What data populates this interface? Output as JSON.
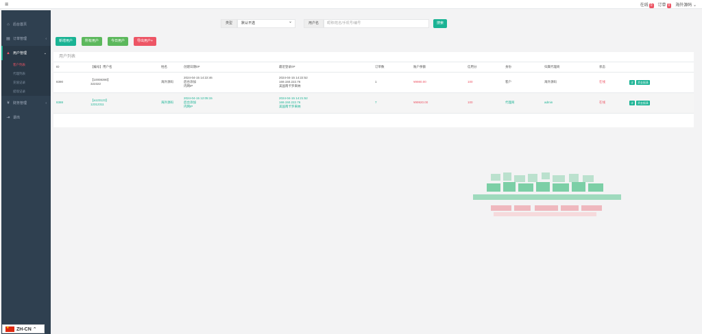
{
  "top": {
    "menu_icon": "hamburger-icon",
    "online_label": "在线",
    "online_count": "0",
    "orders_label": "订单",
    "orders_count": "0",
    "user": "海外源码 ⌄"
  },
  "sidebar": {
    "items": [
      {
        "label": "后台首页",
        "icon": "home-icon"
      },
      {
        "label": "订单管理",
        "icon": "order-icon"
      },
      {
        "label": "用户管理",
        "icon": "user-icon"
      },
      {
        "label": "财务管理",
        "icon": "money-icon"
      },
      {
        "label": "退出",
        "icon": "exit-icon"
      }
    ],
    "sub_items": [
      "客户列表",
      "代理列表",
      "充值记录",
      "提现记录"
    ]
  },
  "language": "ZH-CN ⌃",
  "search": {
    "type_label": "类型",
    "type_value": "默认不选",
    "user_label": "用户名",
    "user_placeholder": "昵称/姓名/手机号/编号",
    "button": "搜索"
  },
  "actions": [
    "新增用户",
    "所有用户",
    "今日用户",
    "导出用户+"
  ],
  "panel_title": "用户列表",
  "table": {
    "headers": [
      "ID",
      "【编号】用户名",
      "姓名",
      "创建日期/IP",
      "最近登录/IP",
      "订单数",
      "账户余额",
      "信用分",
      "身份",
      "归属代理商",
      "状态",
      ""
    ],
    "rows": [
      {
        "id": "8390",
        "user_line1": "【10008390】",
        "user_line2": "322322",
        "name": "海外源码",
        "created_line1": "2024-04-15 14:22:46",
        "created_line2": "后台添加",
        "created_line3": "内网IP",
        "login_line1": "2024-04-15 14:22:52",
        "login_line2": "169.150.222.76",
        "login_line3": "美国南卡罗来纳",
        "orders": "1",
        "balance": "¥9980.00",
        "credit": "100",
        "role": "客户",
        "agent": "海外源码",
        "status": "在线",
        "btn1": "详",
        "btn2": "资金报表"
      },
      {
        "id": "8388",
        "user_line1": "【a123123】",
        "user_line2": "12312311",
        "name": "海外源码",
        "created_line1": "2024-04-15 12:05:15",
        "created_line2": "后台添加",
        "created_line3": "内网IP",
        "login_line1": "2024-04-15 14:21:52",
        "login_line2": "169.150.222.76",
        "login_line3": "美国南卡罗来纳",
        "orders": "7",
        "balance": "¥99920.00",
        "credit": "100",
        "role": "代理商",
        "agent": "admin",
        "status": "在线",
        "btn1": "详",
        "btn2": "资金报表"
      }
    ]
  },
  "colors": {
    "accent": "#1ab394",
    "danger": "#ed5565",
    "sidebar": "#2f4050"
  }
}
